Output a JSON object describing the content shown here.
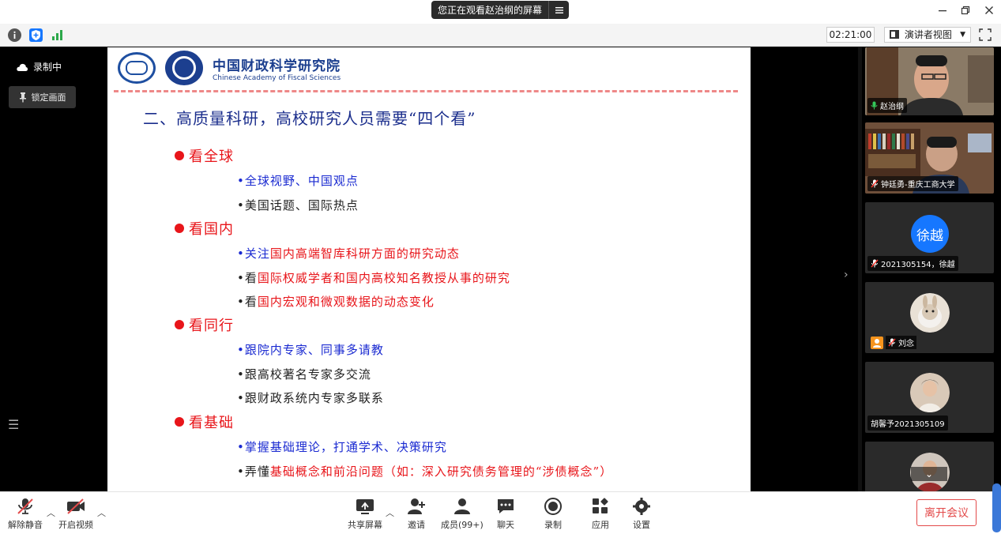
{
  "titlebar": {
    "sharing_notice": "您正在观看赵治纲的屏幕",
    "menu_icon": "list-icon",
    "window_controls": [
      "minimize-icon",
      "restore-icon",
      "close-icon"
    ]
  },
  "infobar": {
    "icons": [
      "info-icon",
      "shield-icon",
      "signal-icon"
    ],
    "timer": "02:21:00",
    "view_mode": "演讲者视图"
  },
  "left": {
    "recording_label": "录制中",
    "lock_view_label": "锁定画面"
  },
  "slide": {
    "institute_cn": "中国财政科学研究院",
    "institute_en": "Chinese Academy of Fiscal Sciences",
    "title": "二、高质量科研，高校研究人员需要“四个看”",
    "sections": [
      {
        "heading": "看全球",
        "items": [
          {
            "parts": [
              {
                "text": "•全球视野、中国观点",
                "color": "blue"
              }
            ]
          },
          {
            "parts": [
              {
                "text": "•美国话题、国际热点",
                "color": "black"
              }
            ]
          }
        ]
      },
      {
        "heading": "看国内",
        "items": [
          {
            "parts": [
              {
                "text": "•关注",
                "color": "blue"
              },
              {
                "text": "国内高端智库科研方面的研究动态",
                "color": "red"
              }
            ]
          },
          {
            "parts": [
              {
                "text": "•看",
                "color": "black"
              },
              {
                "text": "国际权威学者和国内高校知名教授从事的研究",
                "color": "red"
              }
            ]
          },
          {
            "parts": [
              {
                "text": "•看",
                "color": "black"
              },
              {
                "text": "国内宏观和微观数据的动态变化",
                "color": "red"
              }
            ]
          }
        ]
      },
      {
        "heading": "看同行",
        "items": [
          {
            "parts": [
              {
                "text": "•跟院内专家、同事多请教",
                "color": "blue"
              }
            ]
          },
          {
            "parts": [
              {
                "text": "•跟高校著名专家多交流",
                "color": "black"
              }
            ]
          },
          {
            "parts": [
              {
                "text": "•跟财政系统内专家多联系",
                "color": "black"
              }
            ]
          }
        ]
      },
      {
        "heading": "看基础",
        "items": [
          {
            "parts": [
              {
                "text": "•掌握基础理论，打通学术、决策研究",
                "color": "blue"
              }
            ]
          },
          {
            "parts": [
              {
                "text": "•弄懂",
                "color": "black"
              },
              {
                "text": "基础概念和前沿问题（如：深入研究债务管理的“涉债概念”）",
                "color": "red"
              }
            ]
          }
        ]
      }
    ]
  },
  "participants": [
    {
      "name": "赵治纲",
      "type": "video",
      "mic": "mic-on-icon"
    },
    {
      "name": "钟廷勇-重庆工商大学",
      "type": "video",
      "mic": "mic-muted-icon"
    },
    {
      "name": "2021305154，徐越",
      "type": "avatar",
      "avatar_text": "徐越",
      "mic": "mic-muted-icon"
    },
    {
      "name": "刘念",
      "type": "photo",
      "mic": "mic-muted-icon"
    },
    {
      "name": "胡馨予2021305109",
      "type": "photo",
      "mic": ""
    },
    {
      "name": "",
      "type": "photo",
      "mic": ""
    }
  ],
  "toolbar": {
    "unmute": "解除静音",
    "start_video": "开启视频",
    "share_screen": "共享屏幕",
    "invite": "邀请",
    "members": "成员(99+)",
    "chat": "聊天",
    "record": "录制",
    "apps": "应用",
    "settings": "设置",
    "leave": "离开会议"
  },
  "colors": {
    "slide_title": "#1a2d8c",
    "heading_red": "#e8151a",
    "item_blue": "#1a2ad1",
    "leave_red": "#e34a4a",
    "avatar_blue": "#1677ff"
  }
}
